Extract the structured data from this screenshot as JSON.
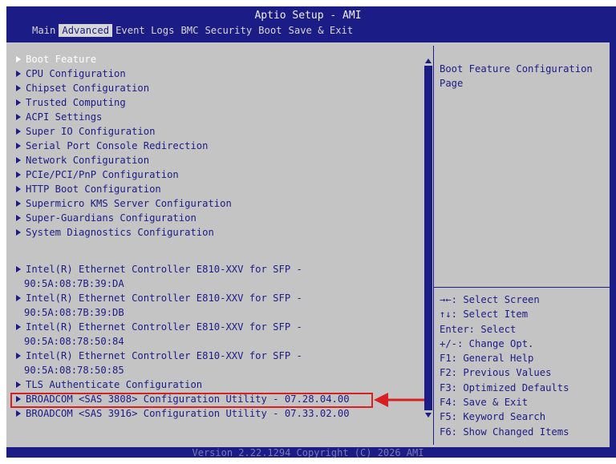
{
  "header": {
    "title": "Aptio Setup - AMI",
    "tabs": [
      "Main",
      "Advanced",
      "Event Logs",
      "BMC",
      "Security",
      "Boot",
      "Save & Exit"
    ],
    "active_tab": "Advanced"
  },
  "menu": {
    "items": [
      "Boot Feature",
      "CPU Configuration",
      "Chipset Configuration",
      "Trusted Computing",
      "ACPI Settings",
      "Super IO Configuration",
      "Serial Port Console Redirection",
      "Network Configuration",
      "PCIe/PCI/PnP Configuration",
      "HTTP Boot Configuration",
      "Supermicro KMS Server Configuration",
      "Super-Guardians Configuration",
      "System Diagnostics Configuration"
    ],
    "ethernet": [
      {
        "label": "Intel(R) Ethernet Controller E810-XXV for SFP -",
        "mac": "90:5A:08:7B:39:DA"
      },
      {
        "label": "Intel(R) Ethernet Controller E810-XXV for SFP -",
        "mac": "90:5A:08:7B:39:DB"
      },
      {
        "label": "Intel(R) Ethernet Controller E810-XXV for SFP -",
        "mac": "90:5A:08:78:50:84"
      },
      {
        "label": "Intel(R) Ethernet Controller E810-XXV for SFP -",
        "mac": "90:5A:08:78:50:85"
      }
    ],
    "tls": "TLS Authenticate Configuration",
    "broadcom_3808": "BROADCOM <SAS 3808> Configuration Utility - 07.28.04.00",
    "broadcom_3916": "BROADCOM <SAS 3916> Configuration Utility - 07.33.02.00"
  },
  "help": {
    "text": "Boot Feature Configuration\nPage"
  },
  "keys": [
    "→←: Select Screen",
    "↑↓: Select Item",
    "Enter: Select",
    "+/-: Change Opt.",
    "F1: General Help",
    "F2: Previous Values",
    "F3: Optimized Defaults",
    "F4: Save & Exit",
    "F5: Keyword Search",
    "F6: Show Changed Items"
  ],
  "footer": {
    "version": "Version 2.22.1294 Copyright (C) 2026 AMI"
  },
  "colors": {
    "bios_blue": "#1c1c86",
    "panel_gray": "#c4c4c4",
    "highlight_red": "#d82020"
  }
}
